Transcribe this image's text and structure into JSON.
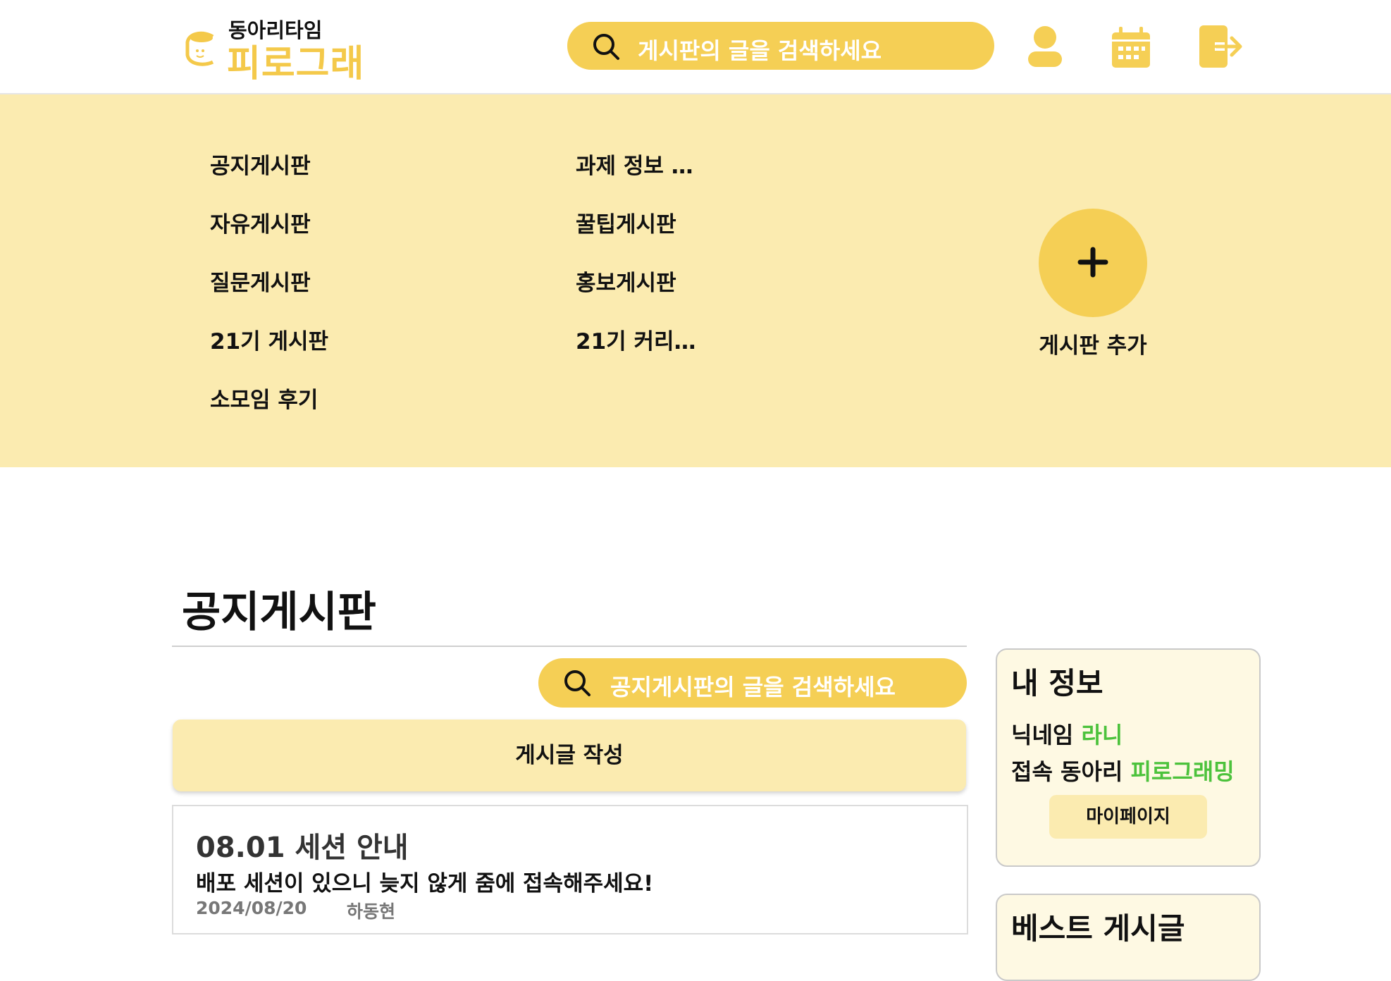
{
  "header": {
    "logo_top": "동아리타임",
    "logo_main": "피로그래밍",
    "search_placeholder": "게시판의 글을 검색하세요",
    "icons": [
      "profile-icon",
      "calendar-icon",
      "logout-icon"
    ]
  },
  "menu": {
    "left": [
      "공지게시판",
      "자유게시판",
      "질문게시판",
      "21기 게시판",
      "소모임 후기"
    ],
    "right": [
      "과제 정보 …",
      "꿀팁게시판",
      "홍보게시판",
      "21기 커리…"
    ],
    "add_label": "게시판 추가"
  },
  "board": {
    "title": "공지게시판",
    "search_placeholder": "공지게시판의 글을 검색하세요",
    "write_label": "게시글 작성",
    "posts": [
      {
        "title": "08.01 세션 안내",
        "body": "배포 세션이 있으니 늦지 않게 줌에 접속해주세요!",
        "date": "2024/08/20",
        "author": "하동현"
      }
    ]
  },
  "my_info": {
    "title": "내 정보",
    "nickname_label": "닉네임",
    "nickname": "라니",
    "club_label": "접속 동아리",
    "club": "피로그래밍",
    "mypage_label": "마이페이지"
  },
  "best": {
    "title": "베스트 게시글"
  },
  "colors": {
    "accent": "#F5CF55",
    "panel": "#FBEBB0",
    "highlight": "#4CC23C"
  }
}
